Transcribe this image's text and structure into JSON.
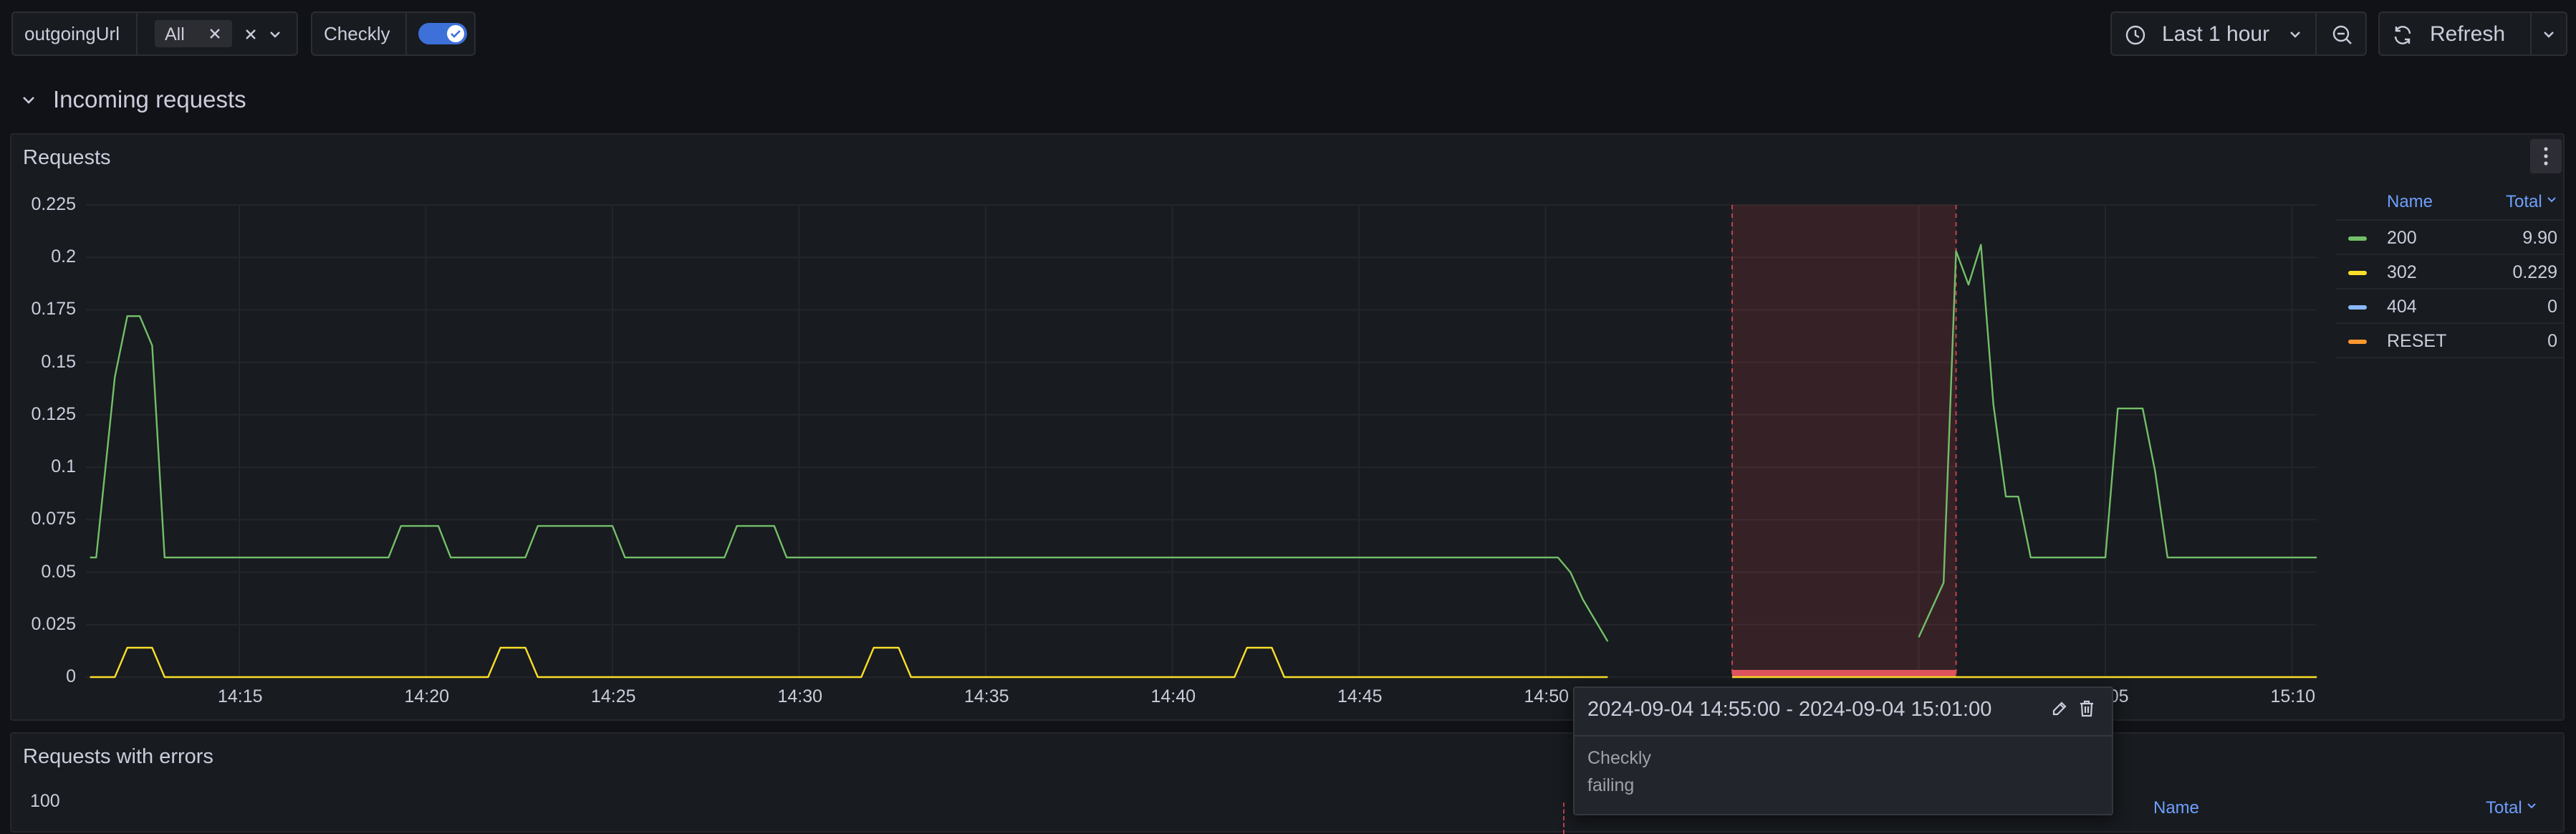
{
  "toolbar": {
    "var_label": "outgoingUrl",
    "var_chip": "All",
    "toggle_label": "Checkly",
    "time_range": "Last 1 hour",
    "refresh_label": "Refresh"
  },
  "row_section": {
    "title": "Incoming requests"
  },
  "panel_requests": {
    "title": "Requests",
    "legend": {
      "col_name": "Name",
      "col_total": "Total",
      "items": [
        {
          "name": "200",
          "total": "9.90",
          "color": "#73bf69"
        },
        {
          "name": "302",
          "total": "0.229",
          "color": "#fade2a"
        },
        {
          "name": "404",
          "total": "0",
          "color": "#8ab8ff"
        },
        {
          "name": "RESET",
          "total": "0",
          "color": "#ff9830"
        }
      ]
    }
  },
  "panel_errors": {
    "title": "Requests with errors",
    "ytick_top": "100",
    "legend_name": "Name",
    "legend_total": "Total"
  },
  "annotation": {
    "range": "2024-09-04 14:55:00 - 2024-09-04 15:01:00",
    "source": "Checkly",
    "text": "failing"
  },
  "chart_data": {
    "type": "line",
    "title": "Requests",
    "xlabel": "",
    "ylabel": "",
    "x_ticks": [
      "14:15",
      "14:20",
      "14:25",
      "14:30",
      "14:35",
      "14:40",
      "14:45",
      "14:50",
      "14:55",
      "15:00",
      "15:05",
      "15:10"
    ],
    "y_ticks": [
      "0",
      "0.025",
      "0.05",
      "0.075",
      "0.1",
      "0.125",
      "0.15",
      "0.175",
      "0.2",
      "0.225"
    ],
    "ylim": [
      0,
      0.225
    ],
    "grid": true,
    "legend_position": "right",
    "series": [
      {
        "name": "200",
        "color": "#73bf69",
        "segments": [
          [
            [
              "14:11:00",
              0.057
            ],
            [
              "14:11:10",
              0.057
            ],
            [
              "14:11:40",
              0.143
            ],
            [
              "14:12:00",
              0.172
            ],
            [
              "14:12:20",
              0.172
            ],
            [
              "14:12:40",
              0.158
            ],
            [
              "14:13:00",
              0.057
            ],
            [
              "14:19:00",
              0.057
            ],
            [
              "14:19:20",
              0.072
            ],
            [
              "14:20:20",
              0.072
            ],
            [
              "14:20:40",
              0.057
            ],
            [
              "14:22:40",
              0.057
            ],
            [
              "14:23:00",
              0.072
            ],
            [
              "14:25:00",
              0.072
            ],
            [
              "14:25:20",
              0.057
            ],
            [
              "14:28:00",
              0.057
            ],
            [
              "14:28:20",
              0.072
            ],
            [
              "14:29:20",
              0.072
            ],
            [
              "14:29:40",
              0.057
            ],
            [
              "14:50:20",
              0.057
            ],
            [
              "14:50:40",
              0.05
            ],
            [
              "14:51:00",
              0.037
            ],
            [
              "14:51:40",
              0.017
            ]
          ],
          [
            [
              "15:00:00",
              0.019
            ],
            [
              "15:00:40",
              0.045
            ],
            [
              "15:01:00",
              0.203
            ],
            [
              "15:01:20",
              0.187
            ],
            [
              "15:01:40",
              0.206
            ],
            [
              "15:02:00",
              0.13
            ],
            [
              "15:02:20",
              0.086
            ],
            [
              "15:02:40",
              0.086
            ],
            [
              "15:03:00",
              0.057
            ],
            [
              "15:05:00",
              0.057
            ],
            [
              "15:05:20",
              0.128
            ],
            [
              "15:06:00",
              0.128
            ],
            [
              "15:06:20",
              0.098
            ],
            [
              "15:06:40",
              0.057
            ],
            [
              "15:10:40",
              0.057
            ]
          ]
        ]
      },
      {
        "name": "302",
        "color": "#fade2a",
        "segments": [
          [
            [
              "14:11:00",
              0
            ],
            [
              "14:11:40",
              0
            ],
            [
              "14:12:00",
              0.014
            ],
            [
              "14:12:40",
              0.014
            ],
            [
              "14:13:00",
              0
            ],
            [
              "14:21:40",
              0
            ],
            [
              "14:22:00",
              0.014
            ],
            [
              "14:22:40",
              0.014
            ],
            [
              "14:23:00",
              0
            ],
            [
              "14:31:40",
              0
            ],
            [
              "14:32:00",
              0.014
            ],
            [
              "14:32:40",
              0.014
            ],
            [
              "14:33:00",
              0
            ],
            [
              "14:41:40",
              0
            ],
            [
              "14:42:00",
              0.014
            ],
            [
              "14:42:40",
              0.014
            ],
            [
              "14:43:00",
              0
            ],
            [
              "14:51:40",
              0
            ]
          ],
          [
            [
              "14:55:00",
              0
            ],
            [
              "15:01:00",
              0
            ]
          ],
          [
            [
              "15:01:00",
              0
            ],
            [
              "15:10:40",
              0
            ]
          ]
        ]
      }
    ],
    "annotation_region": {
      "from": "14:55:00",
      "to": "15:01:00",
      "label": "failing"
    }
  }
}
